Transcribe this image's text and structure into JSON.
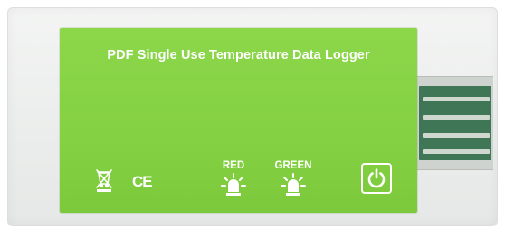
{
  "label": {
    "title": "PDF Single Use Temperature Data Logger",
    "background_color": "#84d143",
    "text_color": "#ffffff"
  },
  "markings": {
    "weee_icon": "crossed-out-wheelie-bin-icon",
    "ce_mark": "CE"
  },
  "indicators": [
    {
      "label": "RED",
      "icon": "led-light-icon"
    },
    {
      "label": "GREEN",
      "icon": "led-light-icon"
    }
  ],
  "power_button": {
    "icon": "power-icon"
  },
  "connector": {
    "type": "USB",
    "contact_color": "#3e7656"
  }
}
